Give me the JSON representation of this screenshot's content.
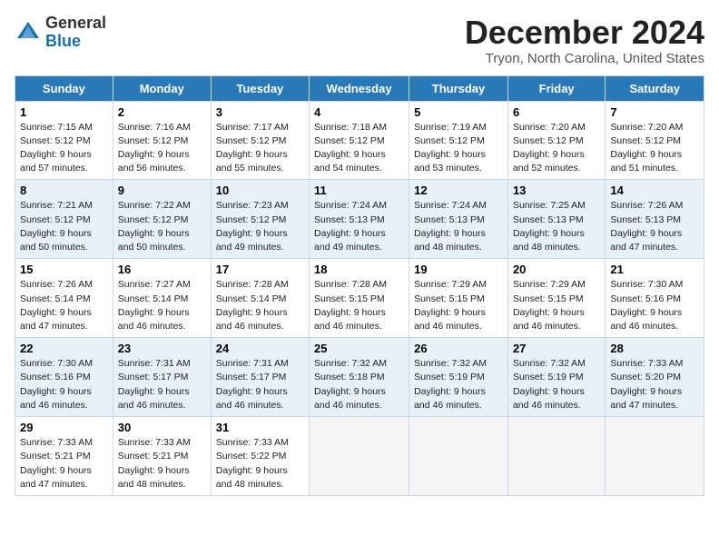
{
  "logo": {
    "general": "General",
    "blue": "Blue"
  },
  "title": "December 2024",
  "subtitle": "Tryon, North Carolina, United States",
  "days_of_week": [
    "Sunday",
    "Monday",
    "Tuesday",
    "Wednesday",
    "Thursday",
    "Friday",
    "Saturday"
  ],
  "weeks": [
    [
      {
        "day": "1",
        "sunrise": "Sunrise: 7:15 AM",
        "sunset": "Sunset: 5:12 PM",
        "daylight": "Daylight: 9 hours and 57 minutes."
      },
      {
        "day": "2",
        "sunrise": "Sunrise: 7:16 AM",
        "sunset": "Sunset: 5:12 PM",
        "daylight": "Daylight: 9 hours and 56 minutes."
      },
      {
        "day": "3",
        "sunrise": "Sunrise: 7:17 AM",
        "sunset": "Sunset: 5:12 PM",
        "daylight": "Daylight: 9 hours and 55 minutes."
      },
      {
        "day": "4",
        "sunrise": "Sunrise: 7:18 AM",
        "sunset": "Sunset: 5:12 PM",
        "daylight": "Daylight: 9 hours and 54 minutes."
      },
      {
        "day": "5",
        "sunrise": "Sunrise: 7:19 AM",
        "sunset": "Sunset: 5:12 PM",
        "daylight": "Daylight: 9 hours and 53 minutes."
      },
      {
        "day": "6",
        "sunrise": "Sunrise: 7:20 AM",
        "sunset": "Sunset: 5:12 PM",
        "daylight": "Daylight: 9 hours and 52 minutes."
      },
      {
        "day": "7",
        "sunrise": "Sunrise: 7:20 AM",
        "sunset": "Sunset: 5:12 PM",
        "daylight": "Daylight: 9 hours and 51 minutes."
      }
    ],
    [
      {
        "day": "8",
        "sunrise": "Sunrise: 7:21 AM",
        "sunset": "Sunset: 5:12 PM",
        "daylight": "Daylight: 9 hours and 50 minutes."
      },
      {
        "day": "9",
        "sunrise": "Sunrise: 7:22 AM",
        "sunset": "Sunset: 5:12 PM",
        "daylight": "Daylight: 9 hours and 50 minutes."
      },
      {
        "day": "10",
        "sunrise": "Sunrise: 7:23 AM",
        "sunset": "Sunset: 5:12 PM",
        "daylight": "Daylight: 9 hours and 49 minutes."
      },
      {
        "day": "11",
        "sunrise": "Sunrise: 7:24 AM",
        "sunset": "Sunset: 5:13 PM",
        "daylight": "Daylight: 9 hours and 49 minutes."
      },
      {
        "day": "12",
        "sunrise": "Sunrise: 7:24 AM",
        "sunset": "Sunset: 5:13 PM",
        "daylight": "Daylight: 9 hours and 48 minutes."
      },
      {
        "day": "13",
        "sunrise": "Sunrise: 7:25 AM",
        "sunset": "Sunset: 5:13 PM",
        "daylight": "Daylight: 9 hours and 48 minutes."
      },
      {
        "day": "14",
        "sunrise": "Sunrise: 7:26 AM",
        "sunset": "Sunset: 5:13 PM",
        "daylight": "Daylight: 9 hours and 47 minutes."
      }
    ],
    [
      {
        "day": "15",
        "sunrise": "Sunrise: 7:26 AM",
        "sunset": "Sunset: 5:14 PM",
        "daylight": "Daylight: 9 hours and 47 minutes."
      },
      {
        "day": "16",
        "sunrise": "Sunrise: 7:27 AM",
        "sunset": "Sunset: 5:14 PM",
        "daylight": "Daylight: 9 hours and 46 minutes."
      },
      {
        "day": "17",
        "sunrise": "Sunrise: 7:28 AM",
        "sunset": "Sunset: 5:14 PM",
        "daylight": "Daylight: 9 hours and 46 minutes."
      },
      {
        "day": "18",
        "sunrise": "Sunrise: 7:28 AM",
        "sunset": "Sunset: 5:15 PM",
        "daylight": "Daylight: 9 hours and 46 minutes."
      },
      {
        "day": "19",
        "sunrise": "Sunrise: 7:29 AM",
        "sunset": "Sunset: 5:15 PM",
        "daylight": "Daylight: 9 hours and 46 minutes."
      },
      {
        "day": "20",
        "sunrise": "Sunrise: 7:29 AM",
        "sunset": "Sunset: 5:15 PM",
        "daylight": "Daylight: 9 hours and 46 minutes."
      },
      {
        "day": "21",
        "sunrise": "Sunrise: 7:30 AM",
        "sunset": "Sunset: 5:16 PM",
        "daylight": "Daylight: 9 hours and 46 minutes."
      }
    ],
    [
      {
        "day": "22",
        "sunrise": "Sunrise: 7:30 AM",
        "sunset": "Sunset: 5:16 PM",
        "daylight": "Daylight: 9 hours and 46 minutes."
      },
      {
        "day": "23",
        "sunrise": "Sunrise: 7:31 AM",
        "sunset": "Sunset: 5:17 PM",
        "daylight": "Daylight: 9 hours and 46 minutes."
      },
      {
        "day": "24",
        "sunrise": "Sunrise: 7:31 AM",
        "sunset": "Sunset: 5:17 PM",
        "daylight": "Daylight: 9 hours and 46 minutes."
      },
      {
        "day": "25",
        "sunrise": "Sunrise: 7:32 AM",
        "sunset": "Sunset: 5:18 PM",
        "daylight": "Daylight: 9 hours and 46 minutes."
      },
      {
        "day": "26",
        "sunrise": "Sunrise: 7:32 AM",
        "sunset": "Sunset: 5:19 PM",
        "daylight": "Daylight: 9 hours and 46 minutes."
      },
      {
        "day": "27",
        "sunrise": "Sunrise: 7:32 AM",
        "sunset": "Sunset: 5:19 PM",
        "daylight": "Daylight: 9 hours and 46 minutes."
      },
      {
        "day": "28",
        "sunrise": "Sunrise: 7:33 AM",
        "sunset": "Sunset: 5:20 PM",
        "daylight": "Daylight: 9 hours and 47 minutes."
      }
    ],
    [
      {
        "day": "29",
        "sunrise": "Sunrise: 7:33 AM",
        "sunset": "Sunset: 5:21 PM",
        "daylight": "Daylight: 9 hours and 47 minutes."
      },
      {
        "day": "30",
        "sunrise": "Sunrise: 7:33 AM",
        "sunset": "Sunset: 5:21 PM",
        "daylight": "Daylight: 9 hours and 48 minutes."
      },
      {
        "day": "31",
        "sunrise": "Sunrise: 7:33 AM",
        "sunset": "Sunset: 5:22 PM",
        "daylight": "Daylight: 9 hours and 48 minutes."
      },
      null,
      null,
      null,
      null
    ]
  ]
}
